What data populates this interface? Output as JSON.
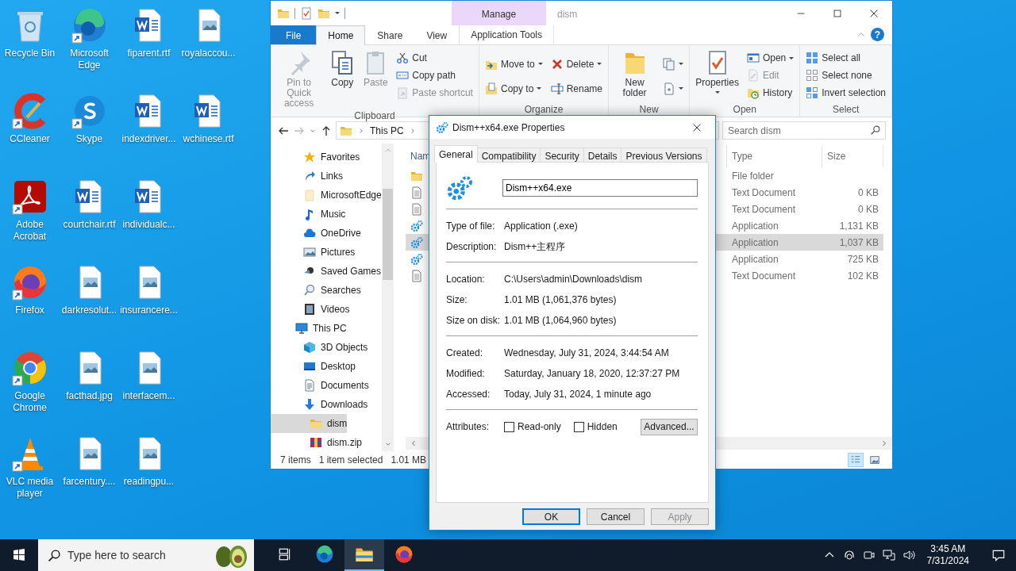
{
  "desktop_icons": [
    {
      "label": "Recycle Bin",
      "kind": "recycle",
      "shortcut": false
    },
    {
      "label": "CCleaner",
      "kind": "ccleaner",
      "shortcut": true
    },
    {
      "label": "Adobe Acrobat",
      "kind": "acrobat",
      "shortcut": true
    },
    {
      "label": "Firefox",
      "kind": "firefox",
      "shortcut": true
    },
    {
      "label": "Google Chrome",
      "kind": "chrome",
      "shortcut": true
    },
    {
      "label": "VLC media player",
      "kind": "vlc",
      "shortcut": true
    },
    {
      "label": "Microsoft Edge",
      "kind": "edge",
      "shortcut": true
    },
    {
      "label": "Skype",
      "kind": "skype",
      "shortcut": true
    },
    {
      "label": "courtchair.rtf",
      "kind": "word",
      "shortcut": false
    },
    {
      "label": "darkresolut...",
      "kind": "image",
      "shortcut": false
    },
    {
      "label": "facthad.jpg",
      "kind": "image",
      "shortcut": false
    },
    {
      "label": "farcentury....",
      "kind": "image",
      "shortcut": false
    },
    {
      "label": "fiparent.rtf",
      "kind": "word",
      "shortcut": false
    },
    {
      "label": "indexdriver...",
      "kind": "word",
      "shortcut": false
    },
    {
      "label": "individualc...",
      "kind": "word",
      "shortcut": false
    },
    {
      "label": "insurancere...",
      "kind": "image",
      "shortcut": false
    },
    {
      "label": "interfacem...",
      "kind": "image",
      "shortcut": false
    },
    {
      "label": "readingpu...",
      "kind": "image",
      "shortcut": false
    },
    {
      "label": "royalaccou...",
      "kind": "image",
      "shortcut": false
    },
    {
      "label": "wchinese.rtf",
      "kind": "word",
      "shortcut": false
    }
  ],
  "explorer": {
    "context_tab": "Manage",
    "title": "dism",
    "help": "?",
    "ribbon_tabs": [
      {
        "label": "File",
        "kind": "file",
        "selected": false
      },
      {
        "label": "Home",
        "kind": "tab",
        "selected": true
      },
      {
        "label": "Share",
        "kind": "tab",
        "selected": false
      },
      {
        "label": "View",
        "kind": "tab",
        "selected": false
      },
      {
        "label": "Application Tools",
        "kind": "context",
        "selected": false
      }
    ],
    "ribbon_groups": [
      {
        "label": "Clipboard",
        "items": [
          {
            "kind": "large",
            "commands": [
              {
                "label": "Pin to Quick access",
                "kind": "pin",
                "disabled": true,
                "dropdown": false
              }
            ]
          },
          {
            "kind": "large",
            "commands": [
              {
                "label": "Copy",
                "kind": "copy",
                "disabled": false,
                "dropdown": false
              }
            ]
          },
          {
            "kind": "large",
            "commands": [
              {
                "label": "Paste",
                "kind": "paste",
                "disabled": true,
                "dropdown": false
              }
            ]
          },
          {
            "kind": "stack",
            "commands": [
              {
                "label": "Cut",
                "kind": "cut",
                "disabled": false,
                "dropdown": false
              },
              {
                "label": "Copy path",
                "kind": "copypath",
                "disabled": false,
                "dropdown": false
              },
              {
                "label": "Paste shortcut",
                "kind": "pasteshortcut",
                "disabled": true,
                "dropdown": false
              }
            ]
          }
        ]
      },
      {
        "label": "Organize",
        "items": [
          {
            "kind": "stack",
            "commands": [
              {
                "label": "Move to",
                "kind": "moveto",
                "disabled": false,
                "dropdown": true
              },
              {
                "label": "Copy to",
                "kind": "copyto",
                "disabled": false,
                "dropdown": true
              }
            ]
          },
          {
            "kind": "stack",
            "commands": [
              {
                "label": "Delete",
                "kind": "delete",
                "disabled": false,
                "dropdown": true
              },
              {
                "label": "Rename",
                "kind": "rename",
                "disabled": false,
                "dropdown": false
              }
            ]
          }
        ]
      },
      {
        "label": "New",
        "items": [
          {
            "kind": "large",
            "commands": [
              {
                "label": "New folder",
                "kind": "newfolder",
                "disabled": false,
                "dropdown": false
              }
            ]
          },
          {
            "kind": "stack",
            "commands": [
              {
                "kind": "newitem",
                "disabled": false,
                "dropdown": true
              },
              {
                "kind": "easyaccess",
                "disabled": false,
                "dropdown": true
              }
            ]
          }
        ]
      },
      {
        "label": "Open",
        "items": [
          {
            "kind": "large",
            "commands": [
              {
                "label": "Properties",
                "kind": "properties",
                "disabled": false,
                "dropdown": true
              }
            ]
          },
          {
            "kind": "stack",
            "commands": [
              {
                "label": "Open",
                "kind": "open",
                "disabled": false,
                "dropdown": true
              },
              {
                "label": "Edit",
                "kind": "edit",
                "disabled": true,
                "dropdown": false
              },
              {
                "label": "History",
                "kind": "history",
                "disabled": false,
                "dropdown": false
              }
            ]
          }
        ]
      },
      {
        "label": "Select",
        "items": [
          {
            "kind": "stack",
            "commands": [
              {
                "label": "Select all",
                "kind": "selectall",
                "disabled": false,
                "dropdown": false
              },
              {
                "label": "Select none",
                "kind": "selectnone",
                "disabled": false,
                "dropdown": false
              },
              {
                "label": "Invert selection",
                "kind": "invert",
                "disabled": false,
                "dropdown": false
              }
            ]
          }
        ]
      }
    ],
    "address": {
      "path": [
        "This PC"
      ]
    },
    "search": {
      "placeholder": "Search dism"
    },
    "nav_pane": {
      "continued_items": [
        {
          "label": "Favorites",
          "kind": "star",
          "selected": false
        },
        {
          "label": "Links",
          "kind": "link",
          "selected": false
        },
        {
          "label": "MicrosoftEdge",
          "kind": "palefolder",
          "selected": false
        },
        {
          "label": "Music",
          "kind": "music",
          "selected": false
        },
        {
          "label": "OneDrive",
          "kind": "cloud",
          "selected": false
        },
        {
          "label": "Pictures",
          "kind": "pictures",
          "selected": false
        },
        {
          "label": "Saved Games",
          "kind": "games",
          "selected": false
        },
        {
          "label": "Searches",
          "kind": "searches",
          "selected": false
        },
        {
          "label": "Videos",
          "kind": "videos",
          "selected": false
        }
      ],
      "items": [
        {
          "label": "This PC",
          "kind": "pc",
          "selected": false,
          "children": [
            {
              "label": "3D Objects",
              "kind": "cube",
              "selected": false
            },
            {
              "label": "Desktop",
              "kind": "desktop",
              "selected": false
            },
            {
              "label": "Documents",
              "kind": "documents",
              "selected": false
            },
            {
              "label": "Downloads",
              "kind": "downloads",
              "selected": false,
              "children": [
                {
                  "label": "dism",
                  "kind": "folder",
                  "selected": true
                },
                {
                  "label": "dism.zip",
                  "kind": "zip",
                  "selected": false
                }
              ]
            }
          ]
        }
      ]
    },
    "columns": [
      {
        "label": "Nam"
      },
      {
        "label": "Type"
      },
      {
        "label": "Size"
      }
    ],
    "rows": [
      {
        "kind": "folder",
        "type": "File folder",
        "selected": false
      },
      {
        "kind": "text",
        "type": "Text Document",
        "size": "0 KB",
        "selected": false
      },
      {
        "kind": "text",
        "type": "Text Document",
        "size": "0 KB",
        "selected": false
      },
      {
        "kind": "app",
        "type": "Application",
        "size": "1,131 KB",
        "selected": false
      },
      {
        "kind": "app",
        "type": "Application",
        "size": "1,037 KB",
        "selected": true
      },
      {
        "kind": "app",
        "type": "Application",
        "size": "725 KB",
        "selected": false
      },
      {
        "kind": "text",
        "type": "Text Document",
        "size": "102 KB",
        "selected": false
      }
    ],
    "status_bar": {
      "count": "7 items",
      "selection": "1 item selected",
      "size": "1.01 MB"
    },
    "views": [
      {
        "kind": "details",
        "selected": true
      },
      {
        "kind": "large",
        "selected": false
      }
    ]
  },
  "properties_dialog": {
    "title": "Dism++x64.exe Properties",
    "tabs": [
      {
        "label": "General",
        "selected": true
      },
      {
        "label": "Compatibility",
        "selected": false
      },
      {
        "label": "Security",
        "selected": false
      },
      {
        "label": "Details",
        "selected": false
      },
      {
        "label": "Previous Versions",
        "selected": false
      }
    ],
    "file_name": "Dism++x64.exe",
    "sections": [
      [
        {
          "label": "Type of file:",
          "value": "Application (.exe)"
        },
        {
          "label": "Description:",
          "value": "Dism++主程序"
        }
      ],
      [
        {
          "label": "Location:",
          "value": "C:\\Users\\admin\\Downloads\\dism"
        },
        {
          "label": "Size:",
          "value": "1.01 MB (1,061,376 bytes)"
        },
        {
          "label": "Size on disk:",
          "value": "1.01 MB (1,064,960 bytes)"
        }
      ],
      [
        {
          "label": "Created:",
          "value": "Wednesday, July 31, 2024, 3:44:54 AM"
        },
        {
          "label": "Modified:",
          "value": "Saturday, January 18, 2020, 12:37:27 PM"
        },
        {
          "label": "Accessed:",
          "value": "Today, July 31, 2024, 1 minute ago"
        }
      ]
    ],
    "attributes_label": "Attributes:",
    "attributes": [
      {
        "label": "Read-only",
        "checked": false
      },
      {
        "label": "Hidden",
        "checked": false
      }
    ],
    "advanced_button": "Advanced...",
    "buttons": [
      {
        "label": "OK",
        "default": true,
        "disabled": false
      },
      {
        "label": "Cancel",
        "default": false,
        "disabled": false
      },
      {
        "label": "Apply",
        "default": false,
        "disabled": true
      }
    ]
  },
  "taskbar": {
    "search_placeholder": "Type here to search",
    "apps": [
      {
        "kind": "taskview",
        "active": false
      },
      {
        "kind": "edge",
        "active": false
      },
      {
        "kind": "explorer",
        "active": true
      },
      {
        "kind": "firefox",
        "active": false
      }
    ],
    "time": "3:45 AM",
    "date": "7/31/2024"
  }
}
